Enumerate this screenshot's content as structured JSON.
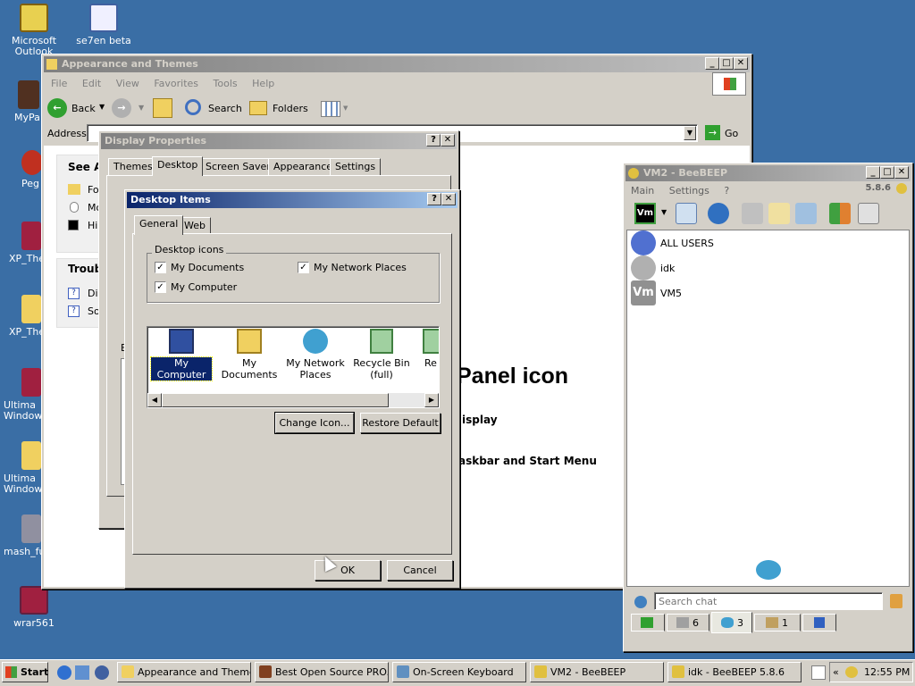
{
  "desktop": {
    "icons": [
      {
        "label": "Microsoft Outlook",
        "icon": "outlook-icon"
      },
      {
        "label": "se7en beta",
        "icon": "file-icon"
      },
      {
        "label": "MyPa",
        "icon": "app-icon"
      },
      {
        "label": "Peg",
        "icon": "app-icon"
      },
      {
        "label": "XP_The",
        "icon": "winrar-icon"
      },
      {
        "label": "XP_The",
        "icon": "folder-icon"
      },
      {
        "label": "Ultima Windows",
        "icon": "winrar-icon"
      },
      {
        "label": "Ultima Windows",
        "icon": "folder-icon"
      },
      {
        "label": "mash_fu",
        "icon": "app-icon"
      },
      {
        "label": "wrar561",
        "icon": "winrar-icon"
      }
    ]
  },
  "explorer": {
    "title": "Appearance and Themes",
    "menu": [
      "File",
      "Edit",
      "View",
      "Favorites",
      "Tools",
      "Help"
    ],
    "toolbar": {
      "back": "Back",
      "search": "Search",
      "folders": "Folders"
    },
    "address_label": "Address",
    "go_label": "Go",
    "see_also_title": "See Al",
    "see_also_items": [
      "Fo",
      "Mo",
      "Hig"
    ],
    "troubleshoot_title": "Troubl",
    "troubleshoot_items": [
      "Dis",
      "So"
    ],
    "panel_heading": "Panel icon",
    "link1": "isplay",
    "link2": "askbar and Start Menu",
    "partial_label": "E"
  },
  "display_properties": {
    "title": "Display Properties",
    "tabs": [
      "Themes",
      "Desktop",
      "Screen Saver",
      "Appearance",
      "Settings"
    ],
    "selected_tab": "Desktop"
  },
  "desktop_items": {
    "title": "Desktop Items",
    "tabs": [
      "General",
      "Web"
    ],
    "group_label": "Desktop icons",
    "checkboxes": [
      {
        "label": "My Documents",
        "checked": true
      },
      {
        "label": "My Network Places",
        "checked": true
      },
      {
        "label": "My Computer",
        "checked": true
      }
    ],
    "icons": [
      {
        "label": "My Computer",
        "icon": "computer-icon"
      },
      {
        "label": "My Documents",
        "icon": "documents-icon"
      },
      {
        "label": "My Network Places",
        "icon": "network-icon"
      },
      {
        "label": "Recycle Bin (full)",
        "icon": "recycle-bin-icon"
      },
      {
        "label": "Re",
        "icon": "recycle-bin-icon"
      }
    ],
    "change_icon": "Change Icon...",
    "restore_default": "Restore Default",
    "ok": "OK",
    "cancel": "Cancel"
  },
  "beebeep": {
    "title": "VM2 - BeeBEEP",
    "menu": [
      "Main",
      "Settings",
      "?"
    ],
    "version": "5.8.6",
    "users": [
      {
        "label": "ALL USERS",
        "icon": "all-users-icon"
      },
      {
        "label": "idk",
        "icon": "user-icon"
      },
      {
        "label": "VM5",
        "icon": "vm-avatar"
      }
    ],
    "vm_badge": "Vm",
    "search_placeholder": "Search chat",
    "bottom_tabs": [
      {
        "label": "",
        "icon": "green-screen-icon"
      },
      {
        "label": "6",
        "icon": "users-icon"
      },
      {
        "label": "3",
        "icon": "chat-icon"
      },
      {
        "label": "1",
        "icon": "group-icon"
      },
      {
        "label": "",
        "icon": "flag-icon"
      }
    ]
  },
  "taskbar": {
    "start": "Start",
    "buttons": [
      {
        "label": "Appearance and Themes",
        "icon": "folder-icon"
      },
      {
        "label": "Best Open Source PRO...",
        "icon": "browser-icon"
      },
      {
        "label": "On-Screen Keyboard",
        "icon": "keyboard-icon"
      },
      {
        "label": "VM2 - BeeBEEP",
        "icon": "beebeep-icon"
      },
      {
        "label": "idk - BeeBEEP 5.8.6",
        "icon": "beebeep-icon"
      }
    ],
    "clock": "12:55 PM"
  }
}
